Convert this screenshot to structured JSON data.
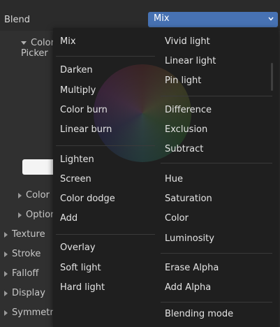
{
  "header": {
    "blend_label": "Blend",
    "selected_value": "Mix"
  },
  "panel": {
    "color_picker_label": "Color Picker",
    "rows": [
      "Color",
      "Options",
      "Texture",
      "Stroke",
      "Falloff",
      "Display",
      "Symmetry"
    ]
  },
  "menu": {
    "left": [
      "Mix",
      "Darken",
      "Multiply",
      "Color burn",
      "Linear burn",
      "Lighten",
      "Screen",
      "Color dodge",
      "Add",
      "Overlay",
      "Soft light",
      "Hard light"
    ],
    "right": [
      "Vivid light",
      "Linear light",
      "Pin light",
      "Difference",
      "Exclusion",
      "Subtract",
      "Hue",
      "Saturation",
      "Color",
      "Luminosity",
      "Erase Alpha",
      "Add Alpha",
      "Blending mode"
    ]
  },
  "colors": {
    "accent": "#4772b3",
    "menu_bg": "#1f1f1f",
    "panel_bg": "#303030"
  },
  "icons": {
    "dropdown": "chevron-down-icon",
    "eyedropper": "eyedropper-icon"
  }
}
